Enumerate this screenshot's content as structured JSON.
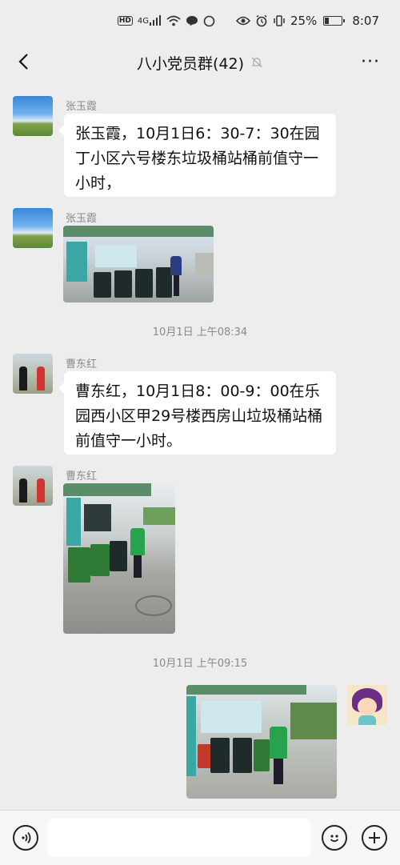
{
  "status_bar": {
    "hd": "HD",
    "network": "4G",
    "battery": "25%",
    "time": "8:07"
  },
  "header": {
    "title": "八小党员群(42)",
    "back_icon": "back-arrow-icon",
    "mute_icon": "bell-muted-icon",
    "more_icon": "more-icon",
    "more_label": "···"
  },
  "messages": [
    {
      "sender": "张玉霞",
      "type": "text",
      "text": "张玉霞，10月1日6：30-7：30在园丁小区六号楼东垃圾桶站桶前值守一小时，"
    },
    {
      "sender": "张玉霞",
      "type": "image"
    },
    {
      "type": "time",
      "text": "10月1日 上午08:34"
    },
    {
      "sender": "曹东红",
      "type": "text",
      "text": "曹东红，10月1日8：00-9：00在乐园西小区甲29号楼西房山垃圾桶站桶前值守一小时。"
    },
    {
      "sender": "曹东红",
      "type": "image"
    },
    {
      "type": "time",
      "text": "10月1日 上午09:15"
    },
    {
      "sender": "self",
      "type": "image"
    }
  ],
  "input_bar": {
    "voice_icon": "voice-icon",
    "emoji_icon": "emoji-icon",
    "plus_icon": "plus-icon",
    "placeholder": ""
  },
  "colors": {
    "background": "#ededed",
    "bubble": "#ffffff",
    "meta_text": "#8a8a8a"
  }
}
